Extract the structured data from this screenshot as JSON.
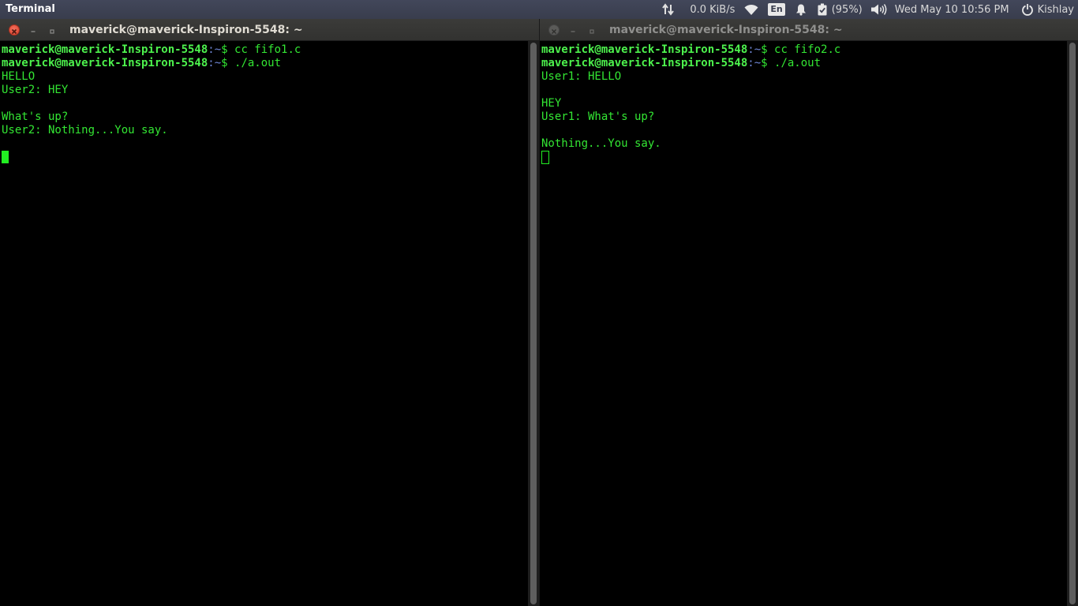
{
  "top_panel": {
    "app_name": "Terminal",
    "network_speed": "0.0 KiB/s",
    "keyboard_layout": "En",
    "battery": "(95%)",
    "datetime": "Wed May 10 10:56 PM",
    "user": "Kishlay"
  },
  "left_window": {
    "title": "maverick@maverick-Inspiron-5548: ~",
    "active": true,
    "lines": [
      {
        "type": "prompt",
        "user": "maverick@maverick-Inspiron-5548",
        "path": ":~",
        "sym": "$ ",
        "cmd": "cc fifo1.c"
      },
      {
        "type": "prompt",
        "user": "maverick@maverick-Inspiron-5548",
        "path": ":~",
        "sym": "$ ",
        "cmd": "./a.out"
      },
      {
        "type": "text",
        "text": "HELLO"
      },
      {
        "type": "text",
        "text": "User2: HEY"
      },
      {
        "type": "text",
        "text": ""
      },
      {
        "type": "text",
        "text": "What's up?"
      },
      {
        "type": "text",
        "text": "User2: Nothing...You say."
      },
      {
        "type": "text",
        "text": ""
      },
      {
        "type": "cursor",
        "style": "block"
      }
    ]
  },
  "right_window": {
    "title": "maverick@maverick-Inspiron-5548: ~",
    "active": false,
    "lines": [
      {
        "type": "prompt",
        "user": "maverick@maverick-Inspiron-5548",
        "path": ":~",
        "sym": "$ ",
        "cmd": "cc fifo2.c"
      },
      {
        "type": "prompt",
        "user": "maverick@maverick-Inspiron-5548",
        "path": ":~",
        "sym": "$ ",
        "cmd": "./a.out"
      },
      {
        "type": "text",
        "text": "User1: HELLO"
      },
      {
        "type": "text",
        "text": ""
      },
      {
        "type": "text",
        "text": "HEY"
      },
      {
        "type": "text",
        "text": "User1: What's up?"
      },
      {
        "type": "text",
        "text": ""
      },
      {
        "type": "text",
        "text": "Nothing...You say."
      },
      {
        "type": "cursor",
        "style": "hollow"
      }
    ]
  },
  "icons": {
    "network": "network-transfer-icon",
    "wifi": "wifi-icon",
    "notifications": "bell-icon",
    "battery": "battery-icon",
    "volume": "volume-icon",
    "session": "power-icon"
  },
  "colors": {
    "terminal_fg": "#33e633",
    "prompt_user": "#4df24d",
    "prompt_path": "#6f86d6",
    "panel_bg": "#3d4152",
    "close_button": "#e0513b"
  }
}
